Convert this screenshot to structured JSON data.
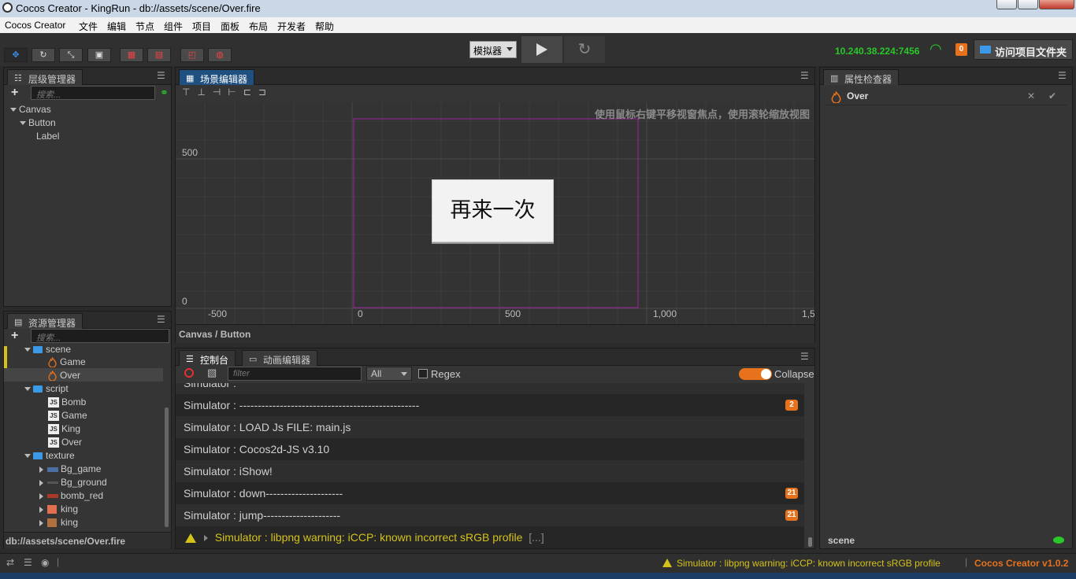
{
  "window": {
    "title": "Cocos Creator - KingRun - db://assets/scene/Over.fire"
  },
  "menu": [
    "Cocos Creator",
    "文件",
    "编辑",
    "节点",
    "组件",
    "项目",
    "面板",
    "布局",
    "开发者",
    "帮助"
  ],
  "toolbar": {
    "platform": "模拟器",
    "ip": "10.240.38.224:7456",
    "notif_count": "0",
    "open_folder": "访问项目文件夹"
  },
  "hierarchy": {
    "title": "层级管理器",
    "search_placeholder": "搜索...",
    "nodes": [
      "Canvas",
      "Button",
      "Label"
    ]
  },
  "assets": {
    "title": "资源管理器",
    "search_placeholder": "搜索...",
    "items": [
      "scene",
      "Game",
      "Over",
      "script",
      "Bomb",
      "Game",
      "King",
      "Over",
      "texture",
      "Bg_game",
      "Bg_ground",
      "bomb_red",
      "king",
      "king"
    ],
    "path": "db://assets/scene/Over.fire"
  },
  "scene_editor": {
    "title": "场景编辑器",
    "hint": "使用鼠标右键平移视窗焦点，使用滚轮缩放视图",
    "y_labels": [
      "500",
      "0"
    ],
    "x_labels": [
      "-500",
      "0",
      "500",
      "1,000",
      "1,5"
    ],
    "button_text": "再来一次",
    "breadcrumb": "Canvas / Button"
  },
  "inspector": {
    "title": "属性检查器",
    "node_name": "Over",
    "footer": "scene"
  },
  "console": {
    "tab_console": "控制台",
    "tab_anim": "动画编辑器",
    "filter_placeholder": "filter",
    "level": "All",
    "regex": "Regex",
    "collapse": "Collapse",
    "logs": [
      {
        "text": "Simulator : ",
        "count": ""
      },
      {
        "text": "Simulator : -------------------------------------------------",
        "count": "2"
      },
      {
        "text": "Simulator : LOAD Js FILE: main.js",
        "count": ""
      },
      {
        "text": "Simulator : Cocos2d-JS v3.10",
        "count": ""
      },
      {
        "text": "Simulator : iShow!",
        "count": ""
      },
      {
        "text": "Simulator : down---------------------",
        "count": "21"
      },
      {
        "text": "Simulator : jump---------------------",
        "count": "21"
      }
    ],
    "warning": "Simulator : libpng warning: iCCP: known incorrect sRGB profile",
    "warning_more": "[...]"
  },
  "status": {
    "warning": "Simulator : libpng warning: iCCP: known incorrect sRGB profile",
    "version": "Cocos Creator v1.0.2"
  },
  "colors": {
    "accent": "#1f5080",
    "badge": "#e8721c",
    "ip": "#28c828",
    "warn": "#d4c21a",
    "version": "#e8721c"
  }
}
